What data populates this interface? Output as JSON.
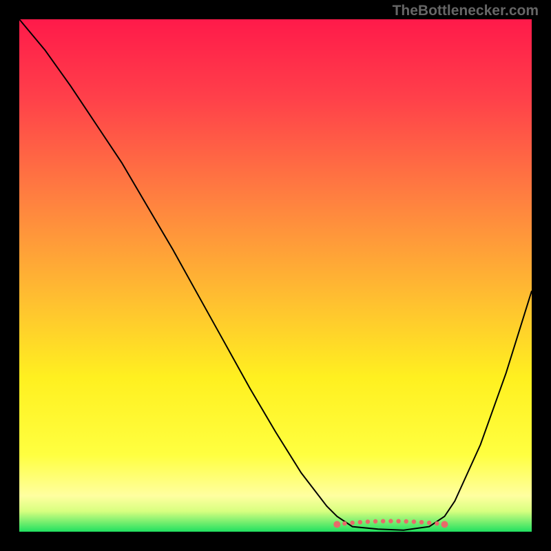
{
  "watermark": "TheBottlenecker.com",
  "chart_data": {
    "type": "line",
    "title": "",
    "xlabel": "",
    "ylabel": "",
    "xlim": [
      0,
      100
    ],
    "ylim": [
      0,
      100
    ],
    "gradient_stops": [
      {
        "offset": 0,
        "color": "#ff1a4a"
      },
      {
        "offset": 15,
        "color": "#ff3f4a"
      },
      {
        "offset": 35,
        "color": "#ff8040"
      },
      {
        "offset": 55,
        "color": "#ffc030"
      },
      {
        "offset": 70,
        "color": "#fff020"
      },
      {
        "offset": 85,
        "color": "#ffff40"
      },
      {
        "offset": 93,
        "color": "#ffffa0"
      },
      {
        "offset": 96,
        "color": "#d8ff80"
      },
      {
        "offset": 100,
        "color": "#20e060"
      }
    ],
    "series": [
      {
        "name": "bottleneck-curve",
        "color": "#000000",
        "x": [
          0,
          5,
          10,
          15,
          20,
          25,
          30,
          35,
          40,
          45,
          50,
          55,
          60,
          62,
          65,
          70,
          75,
          80,
          83,
          85,
          90,
          95,
          100
        ],
        "y": [
          100,
          94,
          87,
          79.5,
          72,
          63.5,
          55,
          46,
          37,
          28,
          19.5,
          11.5,
          5,
          3,
          1,
          0.5,
          0.3,
          1,
          3,
          6,
          17,
          31,
          47
        ]
      }
    ],
    "highlight": {
      "name": "optimal-range",
      "color": "#e86a6a",
      "x_range": [
        62,
        83
      ],
      "y": 1.8,
      "style": "dashed-dots"
    }
  }
}
